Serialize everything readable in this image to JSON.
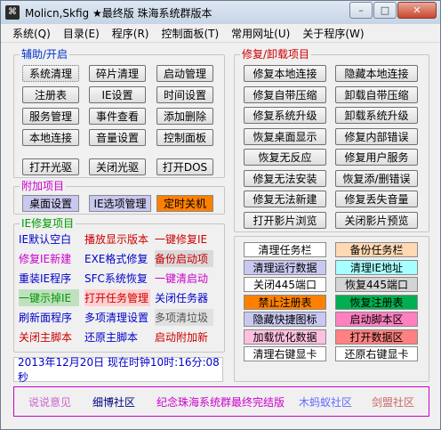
{
  "window": {
    "title": "Molicn,Skfig ★最终版 珠海系统群版本",
    "controls": {
      "minimize": "–",
      "maximize": "□",
      "close": "✕"
    }
  },
  "menu": [
    "系统(Q)",
    "目录(E)",
    "程序(R)",
    "控制面板(T)",
    "常用网址(U)",
    "关于程序(W)"
  ],
  "groups": {
    "assist": "辅助/开启",
    "addon": "附加项目",
    "ie": "IE修复项目",
    "repair": "修复/卸载项目"
  },
  "assist_buttons": [
    [
      "系统清理",
      "碎片清理",
      "启动管理"
    ],
    [
      "注册表",
      "IE设置",
      "时间设置"
    ],
    [
      "服务管理",
      "事件查看",
      "添加删除"
    ],
    [
      "本地连接",
      "音量设置",
      "控制面板"
    ]
  ],
  "drive_buttons": [
    "打开光驱",
    "关闭光驱",
    "打开DOS"
  ],
  "addon_buttons": [
    "桌面设置",
    "IE选项管理",
    "定时关机"
  ],
  "ie_items": [
    [
      "IE默认空白",
      "播放显示版本",
      "一键修复IE"
    ],
    [
      "修复IE新建",
      "EXE格式修复",
      "备份启动项"
    ],
    [
      "重装IE程序",
      "SFC系统恢复",
      "一键清启动"
    ],
    [
      "一键示掉IE",
      "打开任务管理",
      "关闭任务器"
    ],
    [
      "刷新面程序",
      "多项清理设置",
      "多项清垃圾"
    ],
    [
      "关闭主脚本",
      "还原主脚本",
      "启动附加新"
    ]
  ],
  "repair_buttons": [
    [
      "修复本地连接",
      "隐藏本地连接"
    ],
    [
      "修复自带压缩",
      "卸载自带压缩"
    ],
    [
      "修复系统升级",
      "卸载系统升级"
    ],
    [
      "恢复桌面显示",
      "修复内部错误"
    ],
    [
      "恢复无反应",
      "修复用户服务"
    ],
    [
      "修复无法安装",
      "恢复添/删错误"
    ],
    [
      "修复无法新建",
      "修复丢失音量"
    ],
    [
      "打开影片浏览",
      "关闭影片预览"
    ]
  ],
  "tool_buttons": [
    [
      "清理任务栏",
      "备份任务栏"
    ],
    [
      "清理运行数据",
      "清理IE地址"
    ],
    [
      "关闭445端口",
      "恢复445端口"
    ],
    [
      "禁止注册表",
      "恢复注册表"
    ],
    [
      "隐藏快捷图标",
      "启动脚本区"
    ],
    [
      "加载优化数据",
      "打开数据区"
    ],
    [
      "清理右键显卡",
      "还原右键显卡"
    ]
  ],
  "status": {
    "text": "2013年12月20日  现在时钟10时:16分:08秒"
  },
  "links": [
    "说说意见",
    "细博社区",
    "纪念珠海系统群最终完结版",
    "木蚂蚁社区",
    "剑盟社区"
  ],
  "colors": {
    "ie_text": [
      "#0000cc",
      "#cc0000",
      "#cc0000",
      "#cc00cc",
      "#0000cc",
      "#cc0000",
      "#0000cc",
      "#0000cc",
      "#cc00cc",
      "#009900",
      "#cc0000",
      "#0000cc",
      "#0000cc",
      "#0000cc",
      "#555555",
      "#cc0000",
      "#0000cc",
      "#cc0000"
    ],
    "tool_bg": [
      "#ffffff",
      "#ffd9b3",
      "#c8c8f0",
      "#a8ffff",
      "#ffffff",
      "#d4d4d4",
      "#ff8000",
      "#00b050",
      "#c8c8f0",
      "#ff80c0",
      "#ffc0e0",
      "#ff8080",
      "#ffffff",
      "#ffffff"
    ],
    "link_text": [
      "#cc66cc",
      "#000080",
      "#cc00cc",
      "#6666ff",
      "#cc6666"
    ]
  }
}
